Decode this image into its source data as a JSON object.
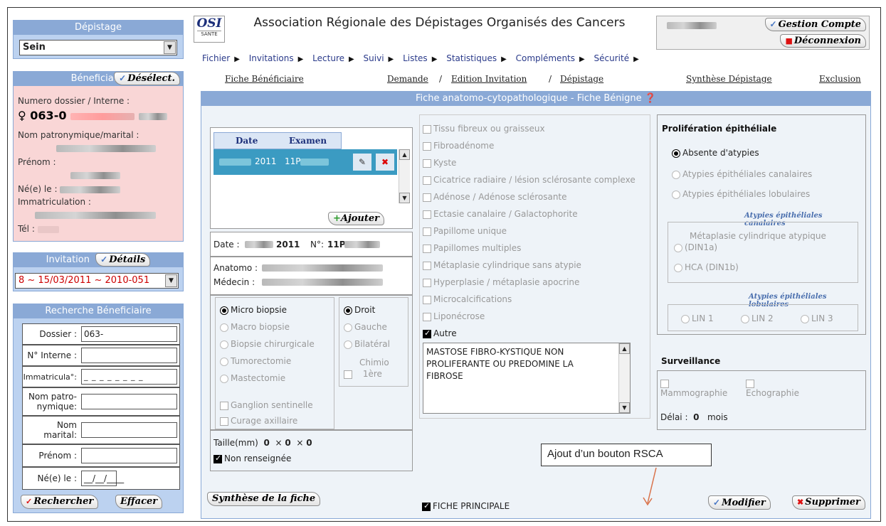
{
  "depistage": {
    "title": "Dépistage",
    "selected": "Sein"
  },
  "beneficiaire": {
    "title": "Béneficiaire",
    "deselect_label": "Désélect.",
    "dossier_label": "Numero dossier / Interne :",
    "dossier_value": "♀ 063-0",
    "nom_label": "Nom patronymique/marital :",
    "prenom_label": "Prénom :",
    "ne_label": "Né(e) le :",
    "immat_label": "Immatriculation :",
    "tel_label": "Tél :"
  },
  "invitation": {
    "title": "Invitation",
    "details_label": "Détails",
    "selected": "8 ~ 15/03/2011 ~ 2010-051"
  },
  "recherche": {
    "title": "Recherche Béneficiaire",
    "fields": [
      {
        "label": "Dossier :",
        "value": "063-"
      },
      {
        "label": "N° Interne :",
        "value": ""
      },
      {
        "label": "Immatricula°:",
        "value": "_ _ _ _ _ _ _ _"
      },
      {
        "label": "Nom patro-nymique:",
        "value": ""
      },
      {
        "label": "Nom marital:",
        "value": ""
      },
      {
        "label": "Prénom :",
        "value": ""
      },
      {
        "label": "Né(e) le :",
        "value": "__/__/____"
      }
    ],
    "rechercher_label": "Rechercher",
    "effacer_label": "Effacer"
  },
  "header": {
    "logo_text": "OSI",
    "logo_sub": "SANTE",
    "title": "Association Régionale des Dépistages Organisés des Cancers",
    "gestion_label": "Gestion Compte",
    "deconnexion_label": "Déconnexion"
  },
  "menu": [
    "Fichier",
    "Invitations",
    "Lecture",
    "Suivi",
    "Listes",
    "Statistiques",
    "Compléments",
    "Sécurité"
  ],
  "subnav": {
    "fiche": "Fiche Bénéficiaire",
    "demande": "Demande",
    "sep": "/",
    "edition": "Edition Invitation",
    "depistage": "Dépistage",
    "synthese": "Synthèse Dépistage",
    "exclusion": "Exclusion"
  },
  "main": {
    "title": "Fiche anatomo-cytopathologique - Fiche Bénigne",
    "table": {
      "col_date": "Date",
      "col_examen": "Examen",
      "row_date": "2011",
      "row_examen": "11P"
    },
    "ajouter_label": "Ajouter",
    "date_label": "Date :",
    "date_value": "2011",
    "no_label": "N°:",
    "no_value": "11P",
    "anatomo_label": "Anatomo :",
    "medecin_label": "Médecin :",
    "prelevement": [
      "Micro biopsie",
      "Macro biopsie",
      "Biopsie chirurgicale",
      "Tumorectomie",
      "Mastectomie"
    ],
    "cote": [
      "Droit",
      "Gauche",
      "Bilatéral"
    ],
    "chimio_label": "Chimio",
    "premiere_label": "1ère",
    "ganglion_label": "Ganglion sentinelle",
    "curage_label": "Curage axillaire",
    "taille_label": "Taille(mm)",
    "taille_a": "0",
    "taille_x": "×",
    "taille_b": "0",
    "taille_c": "0",
    "non_renseignee": "Non renseignée",
    "synthese_label": "Synthèse de la fiche",
    "lesions": [
      "Tissu fibreux ou graisseux",
      "Fibroadénome",
      "Kyste",
      "Cicatrice radiaire / lésion sclérosante complexe",
      "Adénose / Adénose sclérosante",
      "Ectasie canalaire / Galactophorite",
      "Papillome unique",
      "Papillomes multiples",
      "Métaplasie cylindrique sans atypie",
      "Hyperplasie / métaplasie apocrine",
      "Microcalcifications",
      "Liponécrose"
    ],
    "autre_label": "Autre",
    "autre_text": "MASTOSE FIBRO-KYSTIQUE NON PROLIFERANTE OU PREDOMINE LA FIBROSE",
    "fiche_principale": "FICHE PRINCIPALE",
    "prolif_title": "Prolifération épithéliale",
    "prolif_opts": [
      "Absente d'atypies",
      "Atypies épithéliales canalaires",
      "Atypies épithéliales lobulaires"
    ],
    "canal_title": "Atypies épithéliales canalaires",
    "canal_opt1": "Métaplasie cylindrique atypique",
    "canal_opt1b": "(DIN1a)",
    "canal_opt2": "HCA (DIN1b)",
    "lob_title": "Atypies épithéliales lobulaires",
    "lin": [
      "LIN 1",
      "LIN 2",
      "LIN 3"
    ],
    "surv_title": "Surveillance",
    "mammo": "Mammographie",
    "echo": "Echographie",
    "delai_label": "Délai :",
    "delai_value": "0",
    "delai_unit": "mois",
    "modifier_label": "Modifier",
    "supprimer_label": "Supprimer"
  },
  "annotation": {
    "text": "Ajout d’un bouton RSCA"
  },
  "colors": {
    "panel_head": "#8aa9d6",
    "panel_blue": "#bcd2f0",
    "panel_pink": "#f9d6d6",
    "annotation_arrow": "#d9724a"
  }
}
